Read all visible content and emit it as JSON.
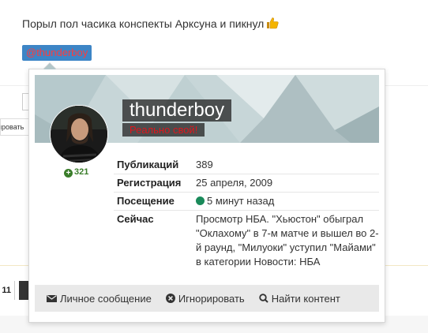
{
  "post": {
    "text": "Порыл пол часика конспекты Арксуна и пикнул",
    "mention": "@thunderboy"
  },
  "background": {
    "tooltip": "ировать",
    "page_number": "11"
  },
  "profile_card": {
    "username": "thunderboy",
    "user_title": "Реально свой!",
    "reputation": "321",
    "stats": [
      {
        "label": "Публикаций",
        "value": "389"
      },
      {
        "label": "Регистрация",
        "value": "25 апреля, 2009"
      },
      {
        "label": "Посещение",
        "value": "5 минут назад"
      },
      {
        "label": "Сейчас",
        "value": "Просмотр НБА. \"Хьюстон\" обыграл \"Оклахому\" в 7-м матче и вышел во 2-й раунд, \"Милуоки\" уступил \"Майами\" в категории Новости: НБА"
      }
    ],
    "actions": {
      "message": "Личное сообщение",
      "ignore": "Игнорировать",
      "find_content": "Найти контент"
    }
  },
  "colors": {
    "mention_bg": "#3d85c6",
    "mention_text": "#ff3b3b",
    "user_title": "#e0151b",
    "reputation": "#3a7d2a",
    "online": "#1a8a5a",
    "footer_bg": "#e9e9e9"
  },
  "icons": [
    "thumbs-up-icon",
    "plus-circle-icon",
    "online-dot-icon",
    "envelope-icon",
    "ignore-icon",
    "search-icon"
  ]
}
